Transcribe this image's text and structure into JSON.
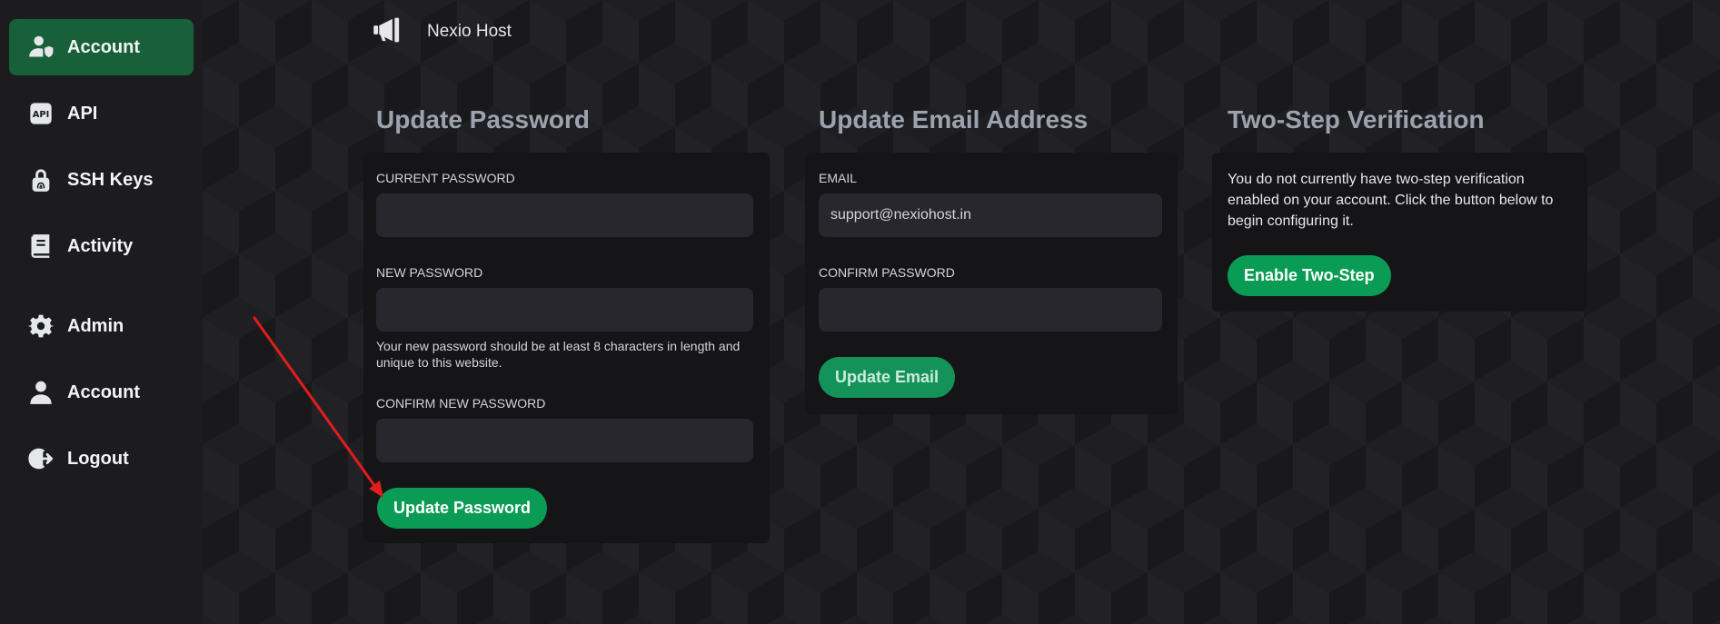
{
  "header": {
    "brand": "Nexio Host",
    "logo_icon": "megaphone-icon"
  },
  "sidebar": {
    "items": [
      {
        "label": "Account",
        "icon": "user-shield-icon",
        "active": true
      },
      {
        "label": "API",
        "icon": "api-icon"
      },
      {
        "label": "SSH Keys",
        "icon": "fingerprint-lock-icon"
      },
      {
        "label": "Activity",
        "icon": "book-icon"
      },
      {
        "label": "Admin",
        "icon": "gear-icon"
      },
      {
        "label": "Account",
        "icon": "user-icon"
      },
      {
        "label": "Logout",
        "icon": "logout-icon"
      }
    ]
  },
  "update_password": {
    "title": "Update Password",
    "current_label": "CURRENT PASSWORD",
    "current_value": "",
    "new_label": "NEW PASSWORD",
    "new_value": "",
    "hint": "Your new password should be at least 8 characters in length and unique to this website.",
    "confirm_label": "CONFIRM NEW PASSWORD",
    "confirm_value": "",
    "button": "Update Password"
  },
  "update_email": {
    "title": "Update Email Address",
    "email_label": "EMAIL",
    "email_value": "support@nexiohost.in",
    "confirm_label": "CONFIRM PASSWORD",
    "confirm_value": "",
    "button": "Update Email"
  },
  "two_step": {
    "title": "Two-Step Verification",
    "description": "You do not currently have two-step verification enabled on your account. Click the button below to begin configuring it.",
    "button": "Enable Two-Step"
  },
  "colors": {
    "accent": "#0a9c55",
    "active_nav": "#17603a",
    "arrow": "#e11d1d"
  }
}
